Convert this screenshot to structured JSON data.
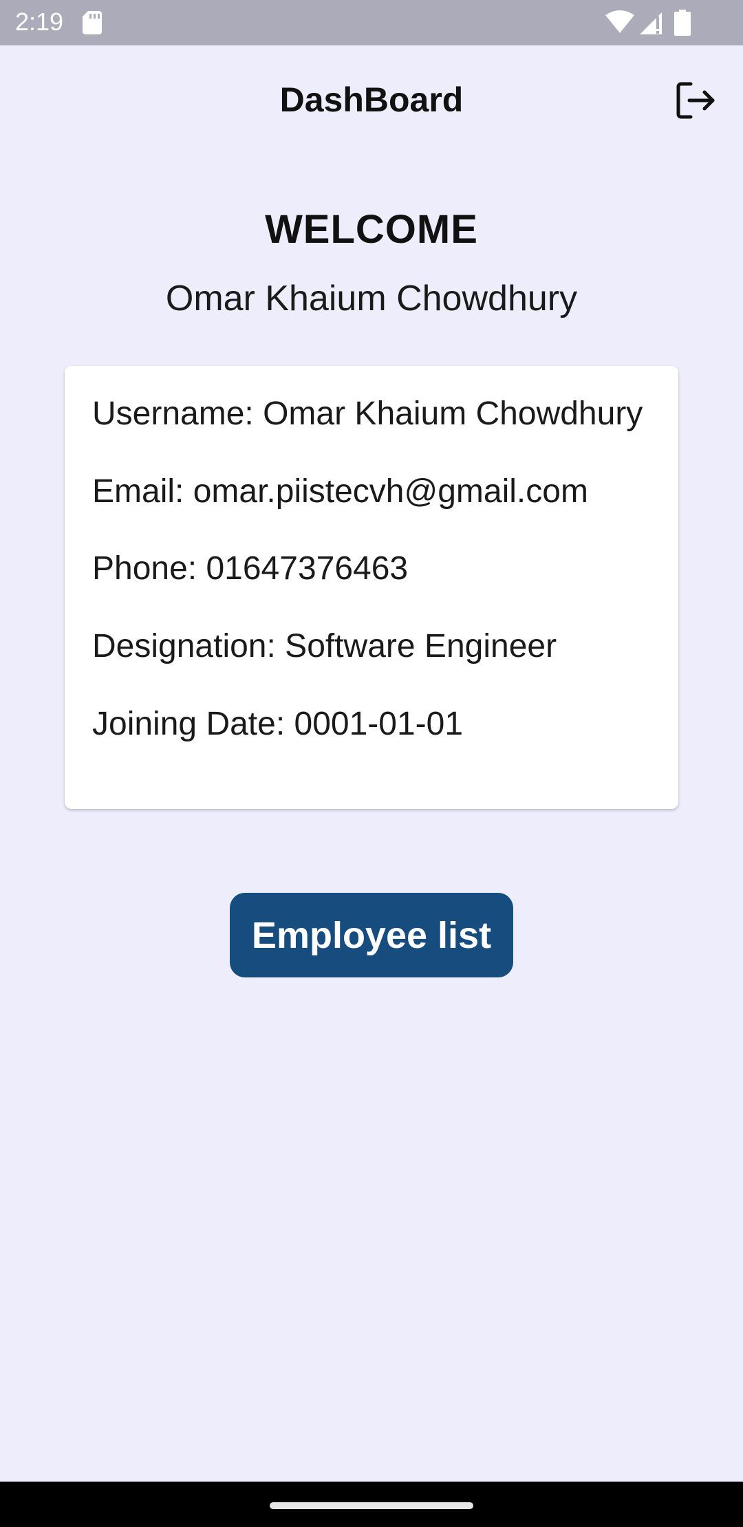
{
  "status_bar": {
    "time": "2:19",
    "icons": [
      "sd-card-icon",
      "wifi-icon",
      "signal-icon",
      "battery-icon"
    ]
  },
  "header": {
    "title": "DashBoard",
    "logout_icon": "logout-icon"
  },
  "welcome": {
    "heading": "WELCOME",
    "name": "Omar Khaium Chowdhury"
  },
  "profile": {
    "username": "Username: Omar Khaium Chowdhury",
    "email": "Email: omar.piistecvh@gmail.com",
    "phone": "Phone: 01647376463",
    "designation": "Designation: Software Engineer",
    "joining_date": "Joining Date: 0001-01-01"
  },
  "actions": {
    "employee_list_label": "Employee list"
  },
  "colors": {
    "background": "#EEEDFB",
    "status_bar": "#ABABB9",
    "primary_button": "#174C7E",
    "card": "#FFFFFF",
    "nav_bar": "#000000"
  }
}
